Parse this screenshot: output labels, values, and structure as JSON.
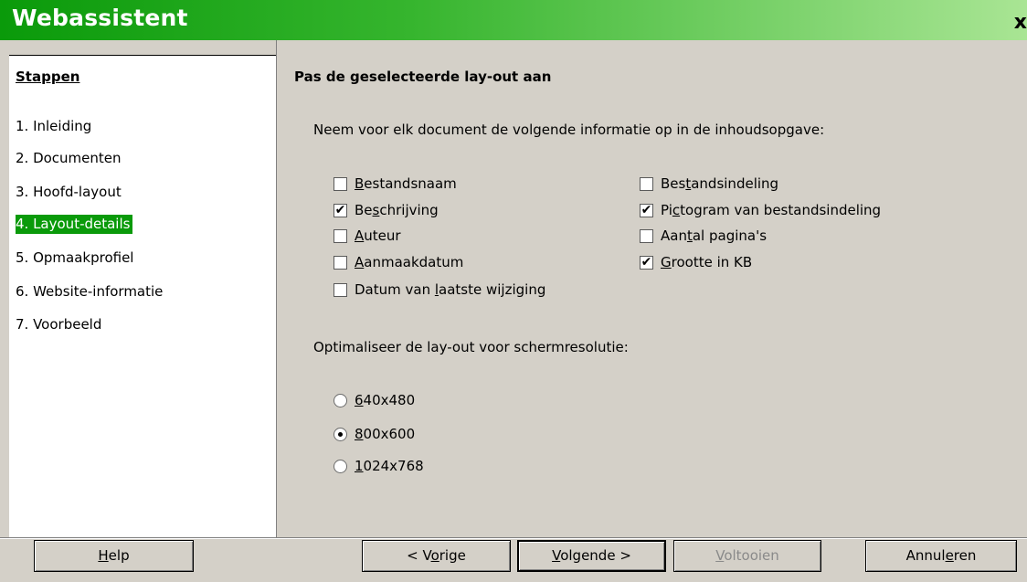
{
  "window": {
    "title": "Webassistent",
    "close_glyph": "x"
  },
  "sidebar": {
    "heading": "Stappen",
    "steps": [
      {
        "label": "1. Inleiding"
      },
      {
        "label": "2. Documenten"
      },
      {
        "label": "3. Hoofd-layout"
      },
      {
        "label": "4. Layout-details"
      },
      {
        "label": "5. Opmaakprofiel"
      },
      {
        "label": "6. Website-informatie"
      },
      {
        "label": "7. Voorbeeld"
      }
    ],
    "active_step": "4. Layout-details"
  },
  "main": {
    "heading": "Pas de geselecteerde lay-out aan",
    "info_description": "Neem voor elk document de volgende informatie op in de inhoudsopgave:",
    "checkboxes": [
      {
        "pre": "",
        "key": "B",
        "post": "estandsnaam",
        "checked": false
      },
      {
        "pre": "Be",
        "key": "s",
        "post": "chrijving",
        "checked": true
      },
      {
        "pre": "",
        "key": "A",
        "post": "uteur",
        "checked": false
      },
      {
        "pre": "",
        "key": "A",
        "post": "anmaakdatum",
        "checked": false
      },
      {
        "pre": "Datum van ",
        "key": "l",
        "post": "aatste wijziging",
        "checked": false
      },
      {
        "pre": "Bes",
        "key": "t",
        "post": "andsindeling",
        "checked": false
      },
      {
        "pre": "Pi",
        "key": "c",
        "post": "togram van bestandsindeling",
        "checked": true
      },
      {
        "pre": "Aan",
        "key": "t",
        "post": "al pagina's",
        "checked": false
      },
      {
        "pre": "",
        "key": "G",
        "post": "rootte in KB",
        "checked": true
      }
    ],
    "resolution_label": "Optimaliseer de lay-out voor schermresolutie:",
    "resolutions": [
      {
        "key": "6",
        "post": "40x480",
        "selected": false
      },
      {
        "key": "8",
        "post": "00x600",
        "selected": true
      },
      {
        "key": "1",
        "post": "024x768",
        "selected": false
      }
    ]
  },
  "buttons": {
    "help": {
      "key": "H",
      "post": "elp"
    },
    "prev": {
      "pre": "< V",
      "key": "o",
      "post": "rige"
    },
    "next": {
      "key": "V",
      "post": "olgende >"
    },
    "finish": {
      "key": "V",
      "post": "oltooien",
      "enabled": false
    },
    "cancel": {
      "pre": "Annul",
      "key": "e",
      "post": "ren"
    }
  },
  "colors": {
    "accent": "#0a9a0a",
    "background": "#d4d0c8"
  }
}
